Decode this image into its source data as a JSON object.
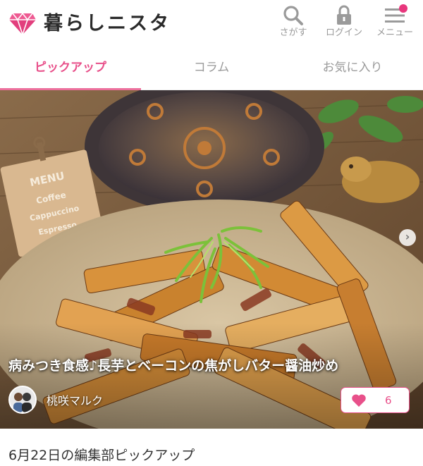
{
  "header": {
    "logo_text": "暮らしニスタ",
    "search": {
      "label": "さがす",
      "icon": "search-icon"
    },
    "login": {
      "label": "ログイン",
      "icon": "lock-icon"
    },
    "menu": {
      "label": "メニュー",
      "icon": "hamburger-icon",
      "has_notification": true
    }
  },
  "tabs": [
    {
      "label": "ピックアップ",
      "active": true
    },
    {
      "label": "コラム",
      "active": false
    },
    {
      "label": "お気に入り",
      "active": false
    }
  ],
  "hero": {
    "title": "病みつき食感♪長芋とベーコンの焦がしバター醤油炒め",
    "author": "桃咲マルク",
    "likes": "6",
    "menu_board": [
      "MENU",
      "Coffee",
      "Cappuccino",
      "Espresso"
    ]
  },
  "section": {
    "title": "6月22日の編集部ピックアップ"
  },
  "colors": {
    "accent": "#e8508a",
    "tab_underline": "#ec6f9c",
    "text_gray": "#9a9a9a"
  }
}
